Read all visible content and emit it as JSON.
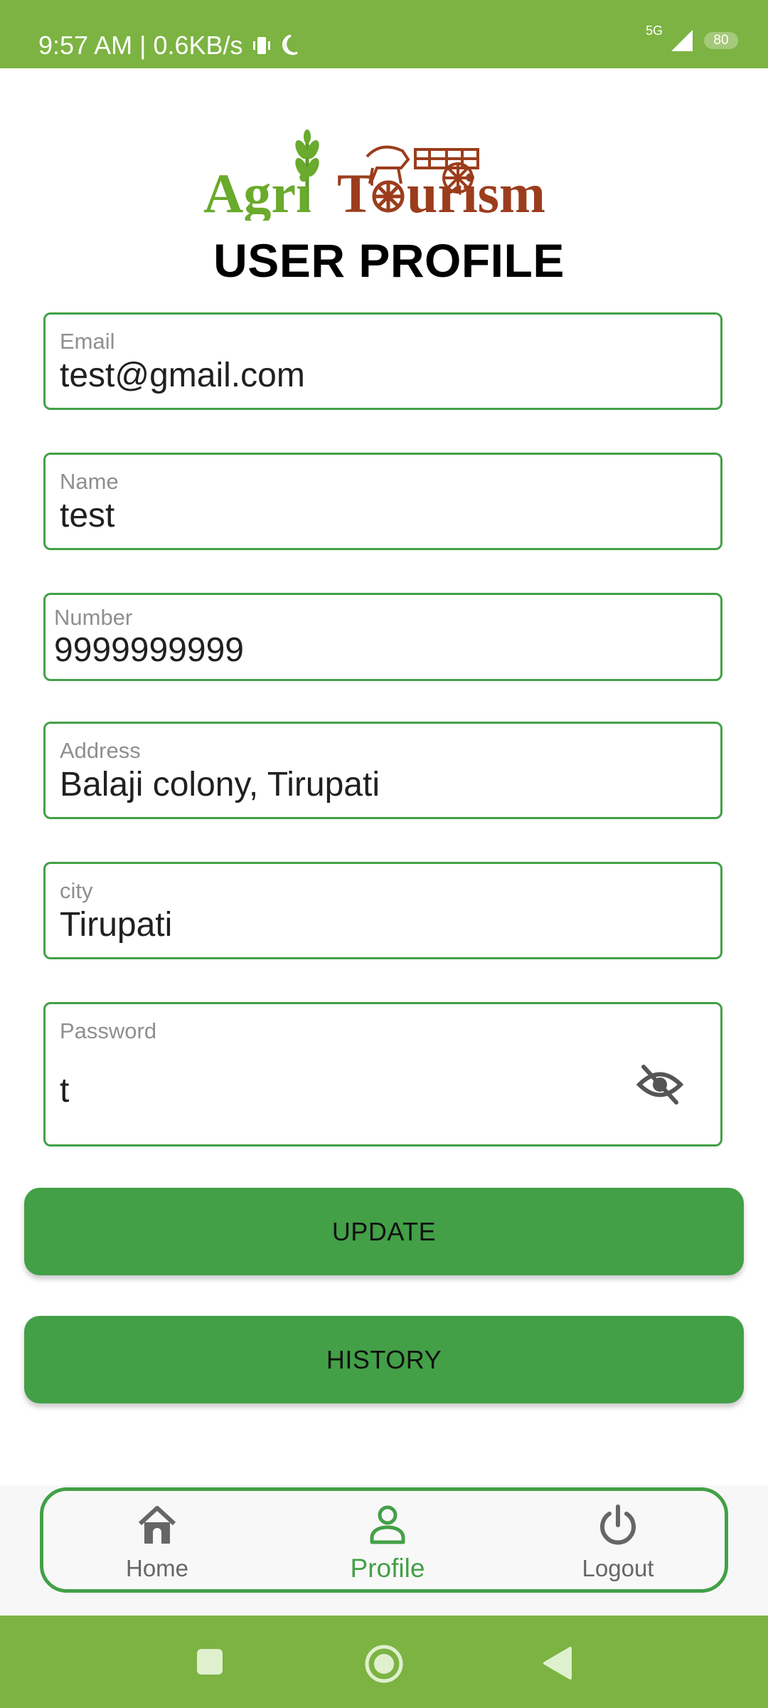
{
  "status_bar": {
    "time_speed": "9:57 AM | 0.6KB/s",
    "network": "5G",
    "battery": "80",
    "color": "#7cb342"
  },
  "logo": {
    "word1": "Agri",
    "word2": "T",
    "word3": "urism"
  },
  "page": {
    "title": "USER PROFILE"
  },
  "fields": {
    "email": {
      "label": "Email",
      "value": "test@gmail.com"
    },
    "name": {
      "label": "Name",
      "value": "test"
    },
    "number": {
      "label": "Number",
      "value": "9999999999"
    },
    "address": {
      "label": "Address",
      "value": "Balaji colony, Tirupati"
    },
    "city": {
      "label": "city",
      "value": "Tirupati"
    },
    "password": {
      "label": "Password",
      "value": "t",
      "toggle_icon": "eye-off-icon"
    }
  },
  "buttons": {
    "update": "UPDATE",
    "history": "HISTORY",
    "color": "#43a047"
  },
  "bottom_nav": {
    "active": "Profile",
    "items": [
      {
        "label": "Home",
        "icon": "home-icon"
      },
      {
        "label": "Profile",
        "icon": "person-icon"
      },
      {
        "label": "Logout",
        "icon": "power-icon"
      }
    ]
  },
  "system_nav": {
    "icons": [
      "recents-icon",
      "home-circle-icon",
      "back-icon"
    ]
  }
}
